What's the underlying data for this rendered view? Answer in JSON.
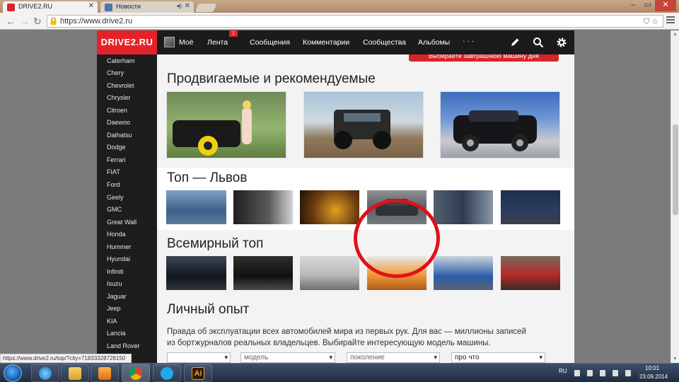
{
  "browser": {
    "tabs": [
      {
        "title": "DRIVE2.RU",
        "favicon_color": "#d9232a"
      },
      {
        "title": "Новости",
        "favicon_color": "#4a76a8"
      }
    ],
    "url": "https://www.drive2.ru",
    "status_url": "https://www.drive2.ru/top/?city=71833328728150"
  },
  "site": {
    "logo": "DRIVE2.RU",
    "brand_color": "#e3232a",
    "nav": {
      "moe": "Моё",
      "lenta": "Лента",
      "lenta_badge": "1",
      "messages": "Сообщения",
      "comments": "Комментарии",
      "communities": "Сообщества",
      "albums": "Альбомы",
      "more": "· · ·"
    },
    "promo_button": "Выбирайте завтрашнюю машину дня",
    "brands": [
      "Caterham",
      "Chery",
      "Chevrolet",
      "Chrysler",
      "Citroen",
      "Daewoo",
      "Daihatsu",
      "Dodge",
      "Ferrari",
      "FIAT",
      "Ford",
      "Geely",
      "GMC",
      "Great Wall",
      "Honda",
      "Hummer",
      "Hyundai",
      "Infiniti",
      "Isuzu",
      "Jaguar",
      "Jeep",
      "KIA",
      "Lancia",
      "Land Rover"
    ],
    "sections": {
      "promoted": "Продвигаемые и рекомендуемые",
      "top_city": "Топ — Львов",
      "world_top": "Всемирный топ",
      "experience": "Личный опыт"
    },
    "experience_text_1": "Правда об эксплуатации всех автомобилей мира из первых рук. Для вас — миллионы записей",
    "experience_text_2": "из бортжурналов реальных владельцев. Выбирайте интересующую модель машины.",
    "filters": {
      "model": "модель",
      "generation": "поколение",
      "about": "про что"
    }
  },
  "taskbar": {
    "lang": "RU",
    "time": "10:01",
    "date": "23.09.2014",
    "ai_label": "Ai"
  }
}
